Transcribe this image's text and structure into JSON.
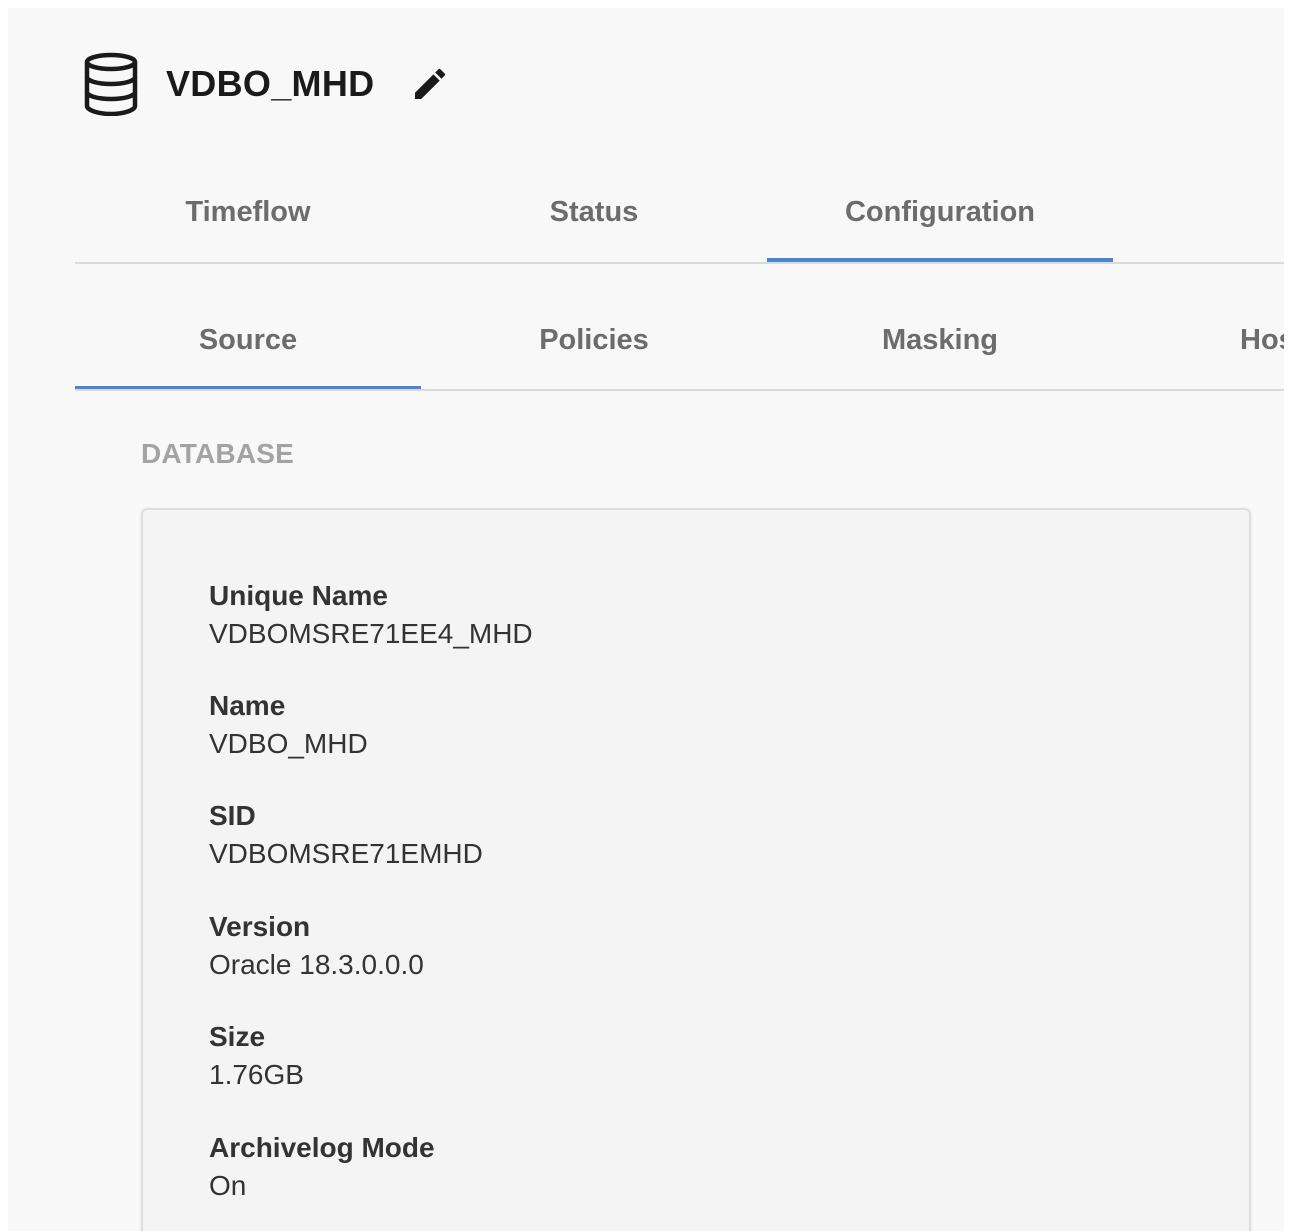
{
  "header": {
    "title": "VDBO_MHD",
    "icon": "database-icon",
    "edit_icon": "pencil-icon"
  },
  "main_tabs": [
    {
      "label": "Timeflow",
      "active": false
    },
    {
      "label": "Status",
      "active": false
    },
    {
      "label": "Configuration",
      "active": true
    }
  ],
  "sub_tabs": [
    {
      "label": "Source",
      "active": true
    },
    {
      "label": "Policies",
      "active": false
    },
    {
      "label": "Masking",
      "active": false
    },
    {
      "label": "Hos",
      "active": false
    }
  ],
  "section": {
    "heading": "DATABASE"
  },
  "fields": [
    {
      "label": "Unique Name",
      "value": "VDBOMSRE71EE4_MHD"
    },
    {
      "label": "Name",
      "value": "VDBO_MHD"
    },
    {
      "label": "SID",
      "value": "VDBOMSRE71EMHD"
    },
    {
      "label": "Version",
      "value": "Oracle 18.3.0.0.0"
    },
    {
      "label": "Size",
      "value": "1.76GB"
    },
    {
      "label": "Archivelog Mode",
      "value": "On"
    }
  ],
  "colors": {
    "accent": "#4a86d0",
    "tab_text": "#6c6c6c",
    "heading_gray": "#a3a3a3",
    "text": "#333333"
  }
}
